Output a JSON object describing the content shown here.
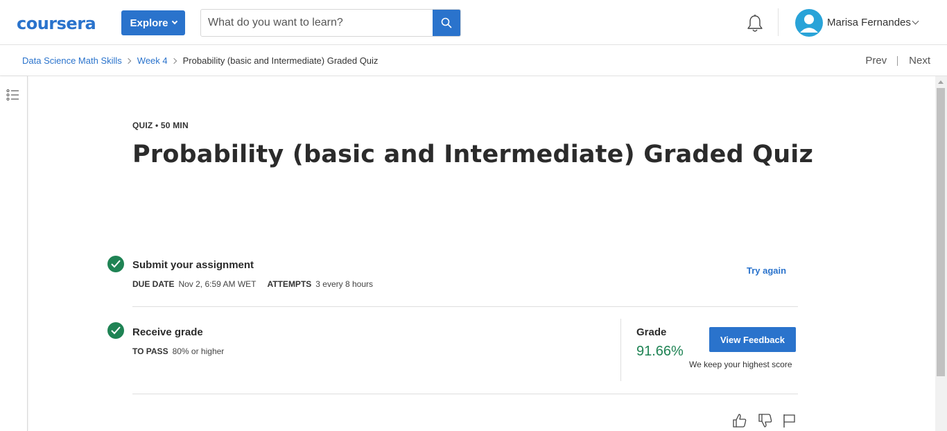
{
  "header": {
    "logo": "coursera",
    "explore_label": "Explore",
    "search_placeholder": "What do you want to learn?",
    "user_name": "Marisa Fernandes"
  },
  "breadcrumb": {
    "items": [
      "Data Science Math Skills",
      "Week 4"
    ],
    "current": "Probability (basic and Intermediate) Graded Quiz"
  },
  "nav": {
    "prev": "Prev",
    "next": "Next"
  },
  "quiz": {
    "eyebrow": "QUIZ • 50 MIN",
    "title": "Probability (basic and Intermediate) Graded Quiz"
  },
  "submit": {
    "title": "Submit your assignment",
    "due_label": "DUE DATE",
    "due_value": "Nov 2, 6:59 AM WET",
    "attempts_label": "ATTEMPTS",
    "attempts_value": "3 every 8 hours",
    "try_again": "Try again"
  },
  "receive": {
    "title": "Receive grade",
    "pass_label": "TO PASS",
    "pass_value": "80% or higher",
    "grade_label": "Grade",
    "grade_value": "91.66%",
    "view_feedback": "View Feedback",
    "highest_note": "We keep your highest score"
  },
  "colors": {
    "brand_blue": "#2a73cc",
    "success_green": "#1f8354"
  }
}
